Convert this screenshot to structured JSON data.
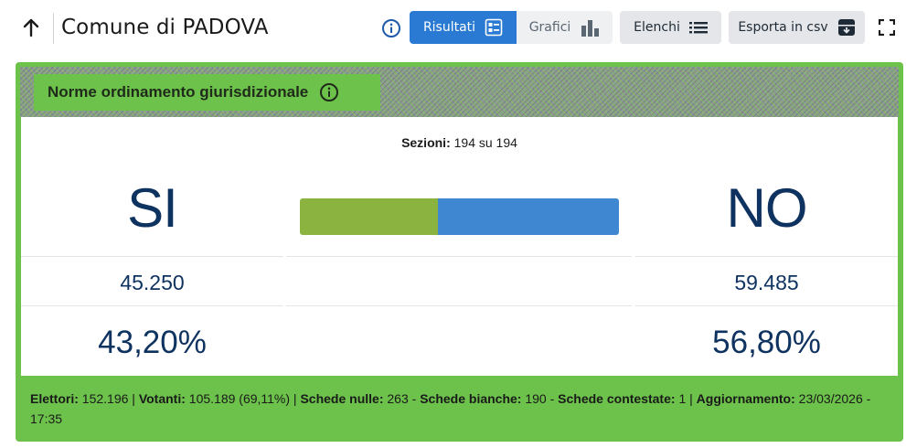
{
  "header": {
    "title": "Comune di PADOVA",
    "tabs": {
      "results_label": "Risultati",
      "charts_label": "Grafici"
    },
    "lists_label": "Elenchi",
    "export_label": "Esporta in csv"
  },
  "card": {
    "question_title": "Norme ordinamento giurisdizionale",
    "sections_label": "Sezioni:",
    "sections_value": "194 su 194",
    "si": {
      "label": "SI",
      "votes": "45.250",
      "percent": "43,20%"
    },
    "no": {
      "label": "NO",
      "votes": "59.485",
      "percent": "56,80%"
    },
    "bar": {
      "si_fraction": 0.432,
      "si_color": "#8ab33f",
      "no_color": "#3f87d0"
    },
    "footer": {
      "electors_label": "Elettori:",
      "electors_value": "152.196",
      "voters_label": "Votanti:",
      "voters_value": "105.189 (69,11%)",
      "null_label": "Schede nulle:",
      "null_value": "263",
      "blank_label": "Schede bianche:",
      "blank_value": "190",
      "contested_label": "Schede contestate:",
      "contested_value": "1",
      "update_label": "Aggiornamento:",
      "update_value": "23/03/2026 - 17:35"
    }
  },
  "colors": {
    "accent": "#2a7ad3",
    "card_green": "#6cc24a",
    "number_navy": "#0f3360"
  },
  "icons": [
    "arrow-up-icon",
    "info-icon",
    "list-detail-icon",
    "bar-chart-icon",
    "list-icon",
    "archive-download-icon",
    "fullscreen-icon"
  ]
}
